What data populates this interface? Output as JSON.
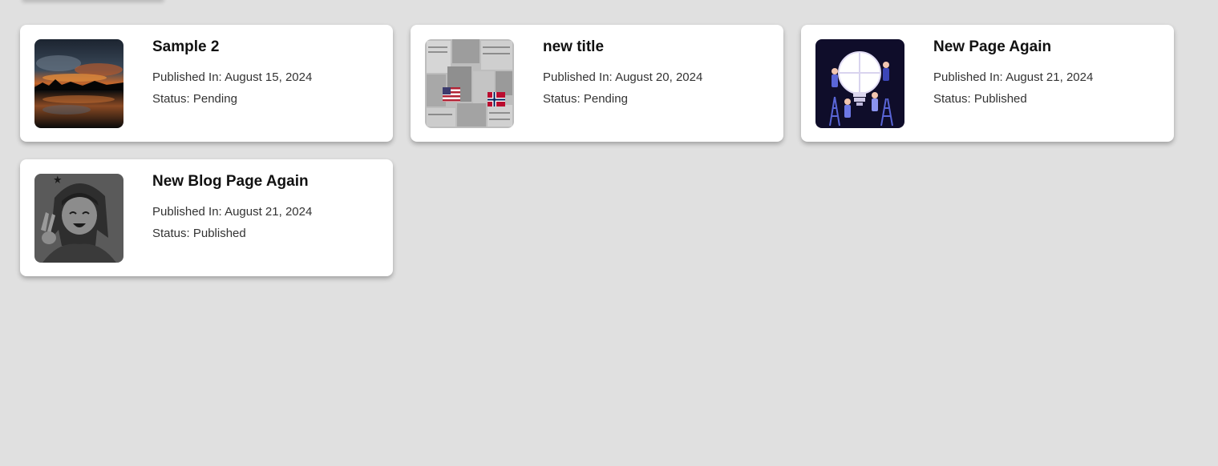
{
  "cards": [
    {
      "title": "Sample 2",
      "published": "Published In: August 15, 2024",
      "status": "Status: Pending",
      "thumbnail": "sunset-lake-image"
    },
    {
      "title": "new title",
      "published": "Published In: August 20, 2024",
      "status": "Status: Pending",
      "thumbnail": "newspaper-collage-image"
    },
    {
      "title": "New Page Again",
      "published": "Published In: August 21, 2024",
      "status": "Status: Published",
      "thumbnail": "lightbulb-puzzle-illustration"
    },
    {
      "title": "New Blog Page Again",
      "published": "Published In: August 21, 2024",
      "status": "Status: Published",
      "thumbnail": "anime-girl-sketch"
    }
  ]
}
